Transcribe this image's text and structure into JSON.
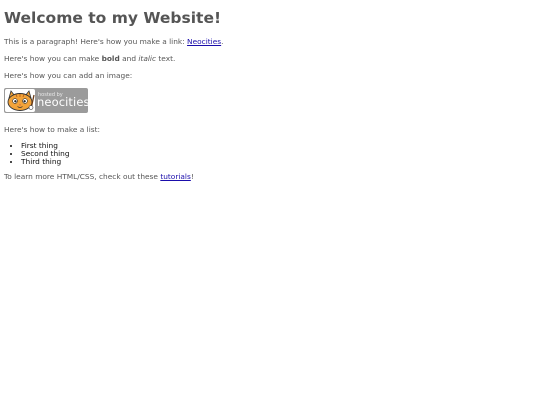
{
  "header": {
    "title": "Welcome to my Website!"
  },
  "intro": {
    "before_link": "This is a paragraph! Here's how you make a link: ",
    "link_text": "Neocities",
    "after_link": "."
  },
  "formatting": {
    "prefix": "Here's how you can make ",
    "bold": "bold",
    "middle": " and ",
    "italic": "italic",
    "suffix": " text."
  },
  "image_section": {
    "text": "Here's how you can add an image:",
    "badge": {
      "small_text": "hosted by",
      "big_text": "neocities",
      "icon": "cat-mascot-icon",
      "background": "#9b9b9b"
    }
  },
  "list_section": {
    "text": "Here's how to make a list:",
    "items": [
      "First thing",
      "Second thing",
      "Third thing"
    ]
  },
  "footer": {
    "before_link": "To learn more HTML/CSS, check out these ",
    "link_text": "tutorials",
    "after_link": "!"
  },
  "colors": {
    "text": "#555555",
    "link": "#1a0dab",
    "list_text": "#111111"
  }
}
